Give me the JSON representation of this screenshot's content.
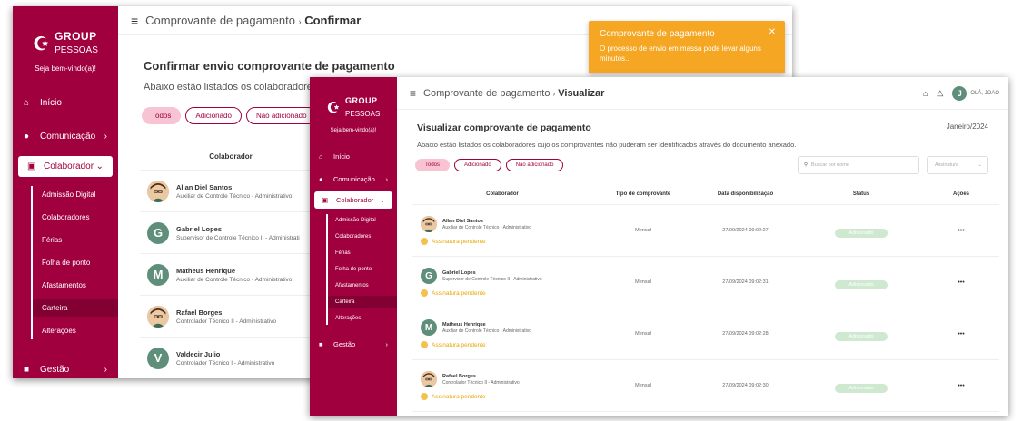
{
  "colors": {
    "brand": "#a0003e",
    "toast": "#f5a623",
    "badge": "#cfe8d0",
    "pending": "#e6a700"
  },
  "logo": {
    "line1": "GROUP",
    "line2": "PESSOAS"
  },
  "welcome": "Seja bem-vindo(a)!",
  "nav": {
    "inicio": "Início",
    "comunicacao": "Comunicação",
    "colaborador": "Colaborador",
    "gestao": "Gestão",
    "sub": [
      "Admissão Digital",
      "Colaboradores",
      "Férias",
      "Folha de ponto",
      "Afastamentos",
      "Carteira",
      "Alterações"
    ]
  },
  "win1": {
    "crumb_parent": "Comprovante de pagamento",
    "crumb_current": "Confirmar",
    "title": "Confirmar envio comprovante de pagamento",
    "subtitle": "Abaixo estão listados os colaboradores cuj",
    "filters": [
      "Todos",
      "Adicionado",
      "Não adicionado"
    ],
    "col_header": "Colaborador",
    "rows": [
      {
        "initial": "",
        "name": "Allan Diel Santos",
        "role": "Auxiliar de Controle Técnico - Administrativo"
      },
      {
        "initial": "G",
        "name": "Gabriel Lopes",
        "role": "Supervisor de Controle Técnico II - Administrati"
      },
      {
        "initial": "M",
        "name": "Matheus Henrique",
        "role": "Auxiliar de Controle Técnico - Administrativo"
      },
      {
        "initial": "",
        "name": "Rafael Borges",
        "role": "Controlador Técnico II - Administrativo"
      },
      {
        "initial": "V",
        "name": "Valdecir Julio",
        "role": "Controlador Técnico I - Administrativo"
      }
    ]
  },
  "toast": {
    "title": "Comprovante de pagamento",
    "message": "O processo de envio em massa pode levar alguns minutos..."
  },
  "win2": {
    "crumb_parent": "Comprovante de pagamento",
    "crumb_current": "Visualizar",
    "user": "OLÁ, JOAO",
    "user_initial": "J",
    "title": "Visualizar comprovante de pagamento",
    "period": "Janeiro/2024",
    "subtitle": "Abaixo estão listados os colaboradores cujo os comprovantes não puderam ser identificados através do documento anexado.",
    "filters": [
      "Todos",
      "Adicionado",
      "Não adicionado"
    ],
    "search_placeholder": "Buscar por nome",
    "select_placeholder": "Assinatura",
    "headers": [
      "Colaborador",
      "Tipo de comprovante",
      "Data disponibilização",
      "Status",
      "Ações"
    ],
    "rows": [
      {
        "initial": "",
        "name": "Allan Diel Santos",
        "role": "Auxiliar de Controle Técnico - Administrativo",
        "pending": "Assinatura pendente",
        "type": "Mensal",
        "date": "27/09/2024 09:02:27",
        "status": "Adicionado",
        "actions": "•••"
      },
      {
        "initial": "G",
        "name": "Gabriel Lopes",
        "role": "Supervisor de Controle Técnico II - Administrativo",
        "pending": "Assinatura pendente",
        "type": "Mensal",
        "date": "27/09/2024 09:02:31",
        "status": "Adicionado",
        "actions": "•••"
      },
      {
        "initial": "M",
        "name": "Matheus Henrique",
        "role": "Auxiliar de Controle Técnico - Administrativo",
        "pending": "Assinatura pendente",
        "type": "Mensal",
        "date": "27/09/2024 09:02:28",
        "status": "Adicionado",
        "actions": "•••"
      },
      {
        "initial": "",
        "name": "Rafael Borges",
        "role": "Controlador Técnico II - Administrativo",
        "pending": "Assinatura pendente",
        "type": "Mensal",
        "date": "27/09/2024 09:02:30",
        "status": "Adicionado",
        "actions": "•••"
      }
    ]
  }
}
